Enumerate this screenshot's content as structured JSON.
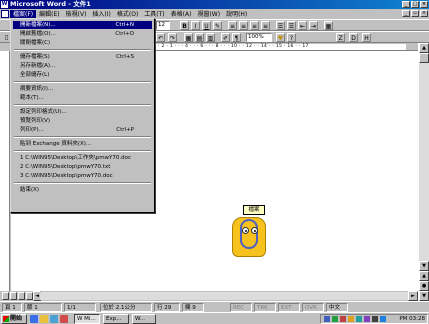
{
  "window": {
    "title": "Microsoft Word - 文件1",
    "icon_label": "W"
  },
  "menubar": {
    "items": [
      "檔案(F)",
      "編輯(E)",
      "檢視(V)",
      "插入(I)",
      "格式(O)",
      "工具(T)",
      "表格(A)",
      "視窗(W)",
      "說明(H)"
    ]
  },
  "toolbar": {
    "font_size": "12",
    "zoom": "100%",
    "bold": "B",
    "italic": "I",
    "underline": "U",
    "text_btn_z": "Z",
    "text_btn_d": "D",
    "text_btn_h": "H"
  },
  "ruler": {
    "text": "· 2 · 1 · · · 4 · · · 6 · · · 8 · · · 10 · · 12 · · 14 · · 15 · 16 · · 17"
  },
  "file_menu": {
    "items": [
      {
        "label": "開新檔案(N)...",
        "shortcut": "Ctrl+N"
      },
      {
        "label": "開啟舊檔(O)...",
        "shortcut": "Ctrl+O"
      },
      {
        "label": "關閉檔案(C)",
        "shortcut": ""
      },
      {
        "label": "儲存檔案(S)",
        "shortcut": "Ctrl+S"
      },
      {
        "label": "另存新檔(A)...",
        "shortcut": ""
      },
      {
        "label": "全部儲存(L)",
        "shortcut": ""
      },
      {
        "label": "摘要資訊(I)...",
        "shortcut": ""
      },
      {
        "label": "範本(T)...",
        "shortcut": ""
      },
      {
        "label": "設定列印格式(U)...",
        "shortcut": ""
      },
      {
        "label": "預覽列印(V)",
        "shortcut": ""
      },
      {
        "label": "列印(P)...",
        "shortcut": "Ctrl+P"
      },
      {
        "label": "貼到 Exchange 資料夾(X)...",
        "shortcut": ""
      },
      {
        "label": "1 C:\\WIN95\\Desktop\\工作夾\\pmwY70.doc",
        "shortcut": ""
      },
      {
        "label": "2 C:\\WIN95\\Desktop\\pmwY70.txt",
        "shortcut": ""
      },
      {
        "label": "3 C:\\WIN95\\Desktop\\pmwY70.doc",
        "shortcut": ""
      },
      {
        "label": "結束(X)",
        "shortcut": ""
      }
    ]
  },
  "assistant": {
    "bubble_text": "檔案"
  },
  "statusbar": {
    "page": "頁 1",
    "section": "節 1",
    "pages": "1/1",
    "position": "位於 2.1公分",
    "line": "行 29",
    "column": "欄 9",
    "rec": "REC",
    "trk": "TRK",
    "ext": "EXT",
    "ovr": "OVR",
    "lang": "中文"
  },
  "taskbar": {
    "start_label": "開始",
    "tasks": [
      "W Mi...",
      "Exp...",
      "W..."
    ],
    "clock": "PM 03:28"
  },
  "colors": {
    "title_bar": "#000080",
    "highlight": "#000080",
    "face": "#c0c0c0"
  }
}
